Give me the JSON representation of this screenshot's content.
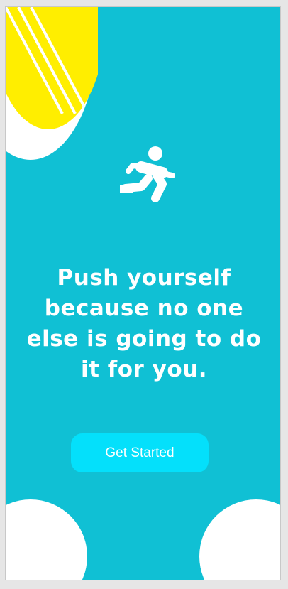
{
  "screen": {
    "background_color": "#10c0d4",
    "accent_color": "#04e0fb",
    "sun_color": "#ffee00"
  },
  "hero": {
    "icon": "running-person-icon",
    "quote": "Push yourself because no one else is going to do it for you."
  },
  "actions": {
    "get_started_label": "Get Started"
  }
}
